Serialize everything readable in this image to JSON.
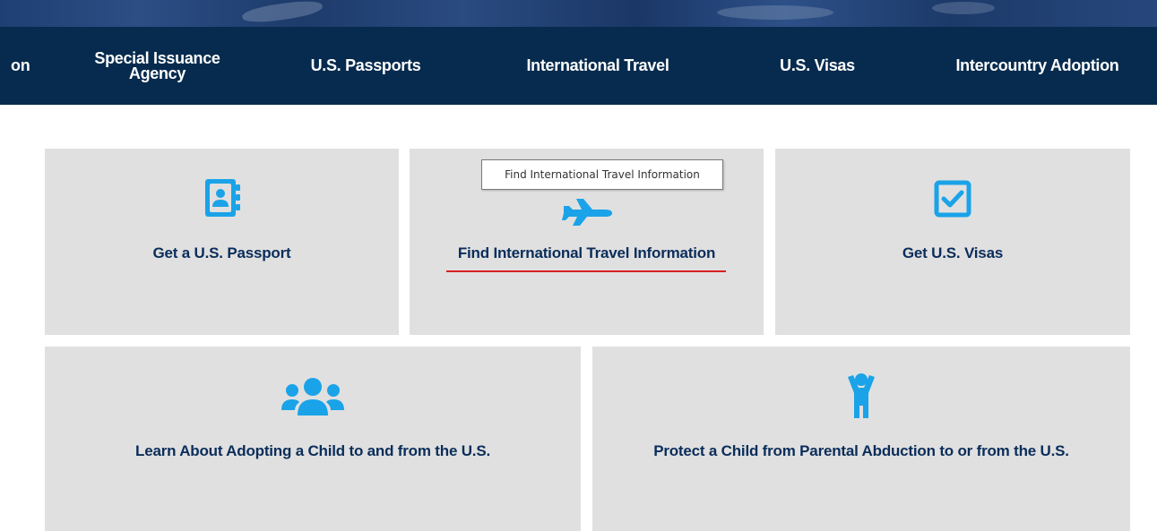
{
  "header": {
    "nav_items": [
      {
        "label": "on"
      },
      {
        "label": "Special Issuance Agency"
      },
      {
        "label": "U.S. Passports"
      },
      {
        "label": "International Travel"
      },
      {
        "label": "U.S. Visas"
      },
      {
        "label": "Intercountry Adoption"
      }
    ]
  },
  "cards": [
    {
      "label": "Get a U.S. Passport",
      "icon": "passport-book-icon"
    },
    {
      "label": "Find International Travel Information",
      "icon": "airplane-icon"
    },
    {
      "label": "Get U.S. Visas",
      "icon": "checkbox-icon"
    },
    {
      "label": "Learn About Adopting a Child to and from the U.S.",
      "icon": "family-group-icon"
    },
    {
      "label": "Protect a Child from Parental Abduction to or from the U.S.",
      "icon": "child-icon"
    }
  ],
  "tooltip": {
    "text": "Find International Travel Information"
  },
  "colors": {
    "nav_background": "#072b4e",
    "card_background": "#e0e0e0",
    "card_text": "#0a2d5a",
    "icon": "#1aa3e8",
    "hover_underline": "#d92121"
  }
}
